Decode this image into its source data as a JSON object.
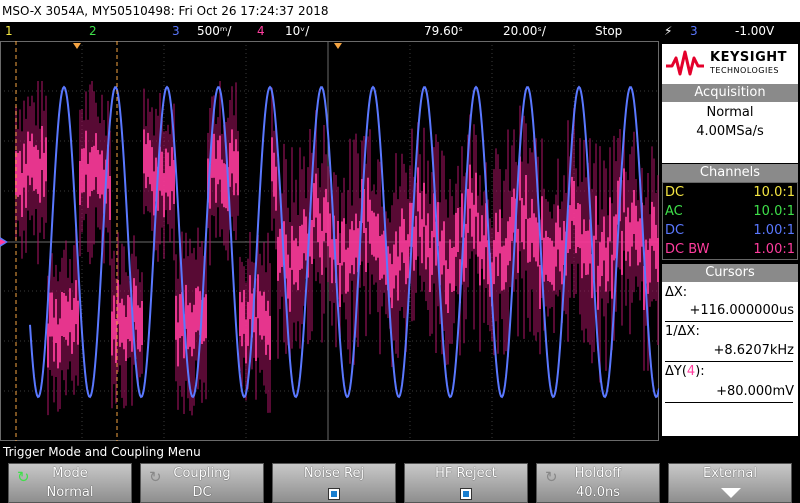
{
  "titlebar": {
    "text": "MSO-X 3054A, MY50510498: Fri Oct 26 17:24:37 2018"
  },
  "status": {
    "ch1_num": "1",
    "ch2_num": "2",
    "ch3_num": "3",
    "ch3_scale": "500ᵐ/",
    "ch4_num": "4",
    "ch4_scale": "10ᵛ/",
    "time_pos": "79.60ˢ",
    "time_scale": "20.00ˢ/",
    "run_state": "Stop",
    "trig_icon": "⚡",
    "trig_src": "3",
    "trig_level": "-1.00V"
  },
  "logo": {
    "brand": "KEYSIGHT",
    "sub": "TECHNOLOGIES"
  },
  "acquisition": {
    "header": "Acquisition",
    "mode": "Normal",
    "rate": "4.00MSa/s"
  },
  "channels": {
    "header": "Channels",
    "rows": [
      {
        "coupling": "DC",
        "probe": "10.0:1",
        "color": "#f5e642"
      },
      {
        "coupling": "AC",
        "probe": "10.0:1",
        "color": "#3fe04a"
      },
      {
        "coupling": "DC",
        "probe": "1.00:1",
        "color": "#5a78ff"
      },
      {
        "coupling": "DC BW",
        "probe": "1.00:1",
        "color": "#ff3d9e"
      }
    ]
  },
  "cursors": {
    "header": "Cursors",
    "dx_label": "ΔX:",
    "dx_value": "+116.000000us",
    "inv_label": "1/ΔX:",
    "inv_value": "+8.6207kHz",
    "dy_label_pre": "ΔY(",
    "dy_label_ch": "4",
    "dy_label_post": "):",
    "dy_value": "+80.000mV"
  },
  "menu_title": "Trigger Mode and Coupling Menu",
  "softkeys": [
    {
      "top": "Mode",
      "bottom": "Normal"
    },
    {
      "top": "Coupling",
      "bottom": "DC"
    },
    {
      "top": "Noise Rej",
      "bottom": ""
    },
    {
      "top": "HF Reject",
      "bottom": ""
    },
    {
      "top": "Holdoff",
      "bottom": "40.0ns"
    },
    {
      "top": "External",
      "bottom": ""
    }
  ],
  "colors": {
    "ch1": "#f5e642",
    "ch2": "#3fe04a",
    "ch3": "#5a78ff",
    "ch4": "#ff3d9e"
  }
}
